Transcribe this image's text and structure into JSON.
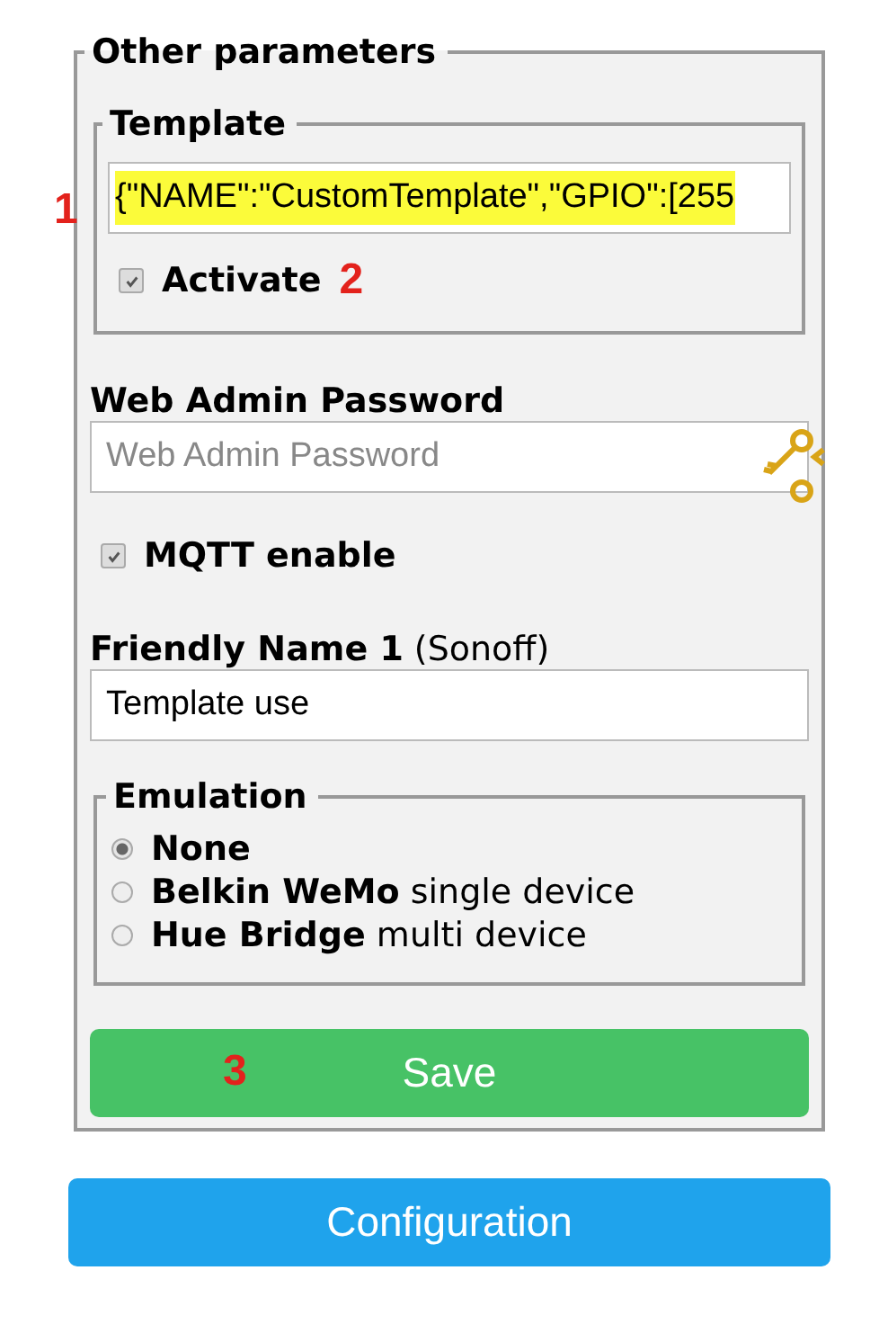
{
  "settings": {
    "legend": "Other parameters",
    "template": {
      "legend": "Template",
      "value": "{\"NAME\":\"CustomTemplate\",\"GPIO\":[255",
      "highlighted": true,
      "activate": {
        "label": "Activate",
        "checked": true
      }
    },
    "password": {
      "label": "Web Admin Password",
      "placeholder": "Web Admin Password"
    },
    "mqtt": {
      "label": "MQTT enable",
      "checked": true
    },
    "friendly_name": {
      "label": "Friendly Name 1",
      "hint": "(Sonoff)",
      "value": "Template use"
    },
    "emulation": {
      "legend": "Emulation",
      "options": [
        {
          "name": "None",
          "selected": true
        },
        {
          "name": "Belkin WeMo",
          "detail": "single device",
          "selected": false
        },
        {
          "name": "Hue Bridge",
          "detail": "multi device",
          "selected": false
        }
      ]
    },
    "save_button": "Save"
  },
  "annotations": [
    "1",
    "2",
    "3"
  ],
  "configuration_button": "Configuration"
}
